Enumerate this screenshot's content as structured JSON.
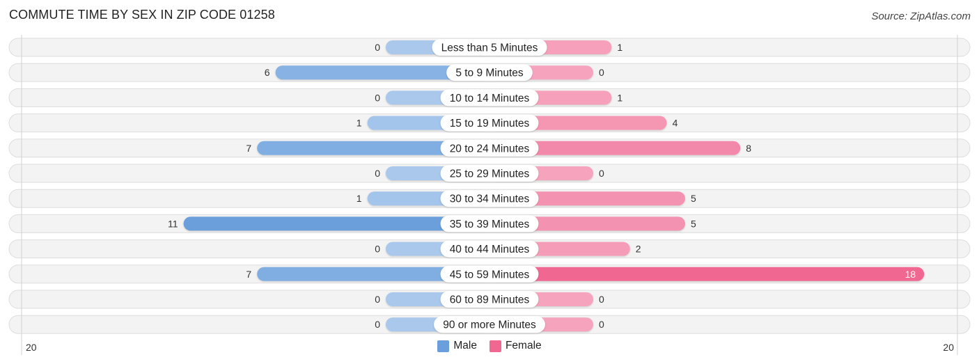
{
  "title": "COMMUTE TIME BY SEX IN ZIP CODE 01258",
  "source": "Source: ZipAtlas.com",
  "colors": {
    "male": "#6a9fdc",
    "male_light": "#a9c8ec",
    "female": "#f06892",
    "female_light": "#f6a3bd",
    "row_bg": "#f3f3f3",
    "row_border": "#dddddd"
  },
  "legend": [
    {
      "label": "Male",
      "color": "#6a9fdc"
    },
    {
      "label": "Female",
      "color": "#f06892"
    }
  ],
  "chart_data": {
    "type": "bar",
    "orientation": "horizontal-diverging",
    "title": "COMMUTE TIME BY SEX IN ZIP CODE 01258",
    "categories": [
      "Less than 5 Minutes",
      "5 to 9 Minutes",
      "10 to 14 Minutes",
      "15 to 19 Minutes",
      "20 to 24 Minutes",
      "25 to 29 Minutes",
      "30 to 34 Minutes",
      "35 to 39 Minutes",
      "40 to 44 Minutes",
      "45 to 59 Minutes",
      "60 to 89 Minutes",
      "90 or more Minutes"
    ],
    "series": [
      {
        "name": "Male",
        "values": [
          0,
          6,
          0,
          1,
          7,
          0,
          1,
          11,
          0,
          7,
          0,
          0
        ]
      },
      {
        "name": "Female",
        "values": [
          1,
          0,
          1,
          4,
          8,
          0,
          5,
          5,
          2,
          18,
          0,
          0
        ]
      }
    ],
    "axis_min_label": "20",
    "axis_max_label": "20",
    "xlim": [
      -20,
      20
    ],
    "legend_position": "bottom-center",
    "grid": false
  }
}
